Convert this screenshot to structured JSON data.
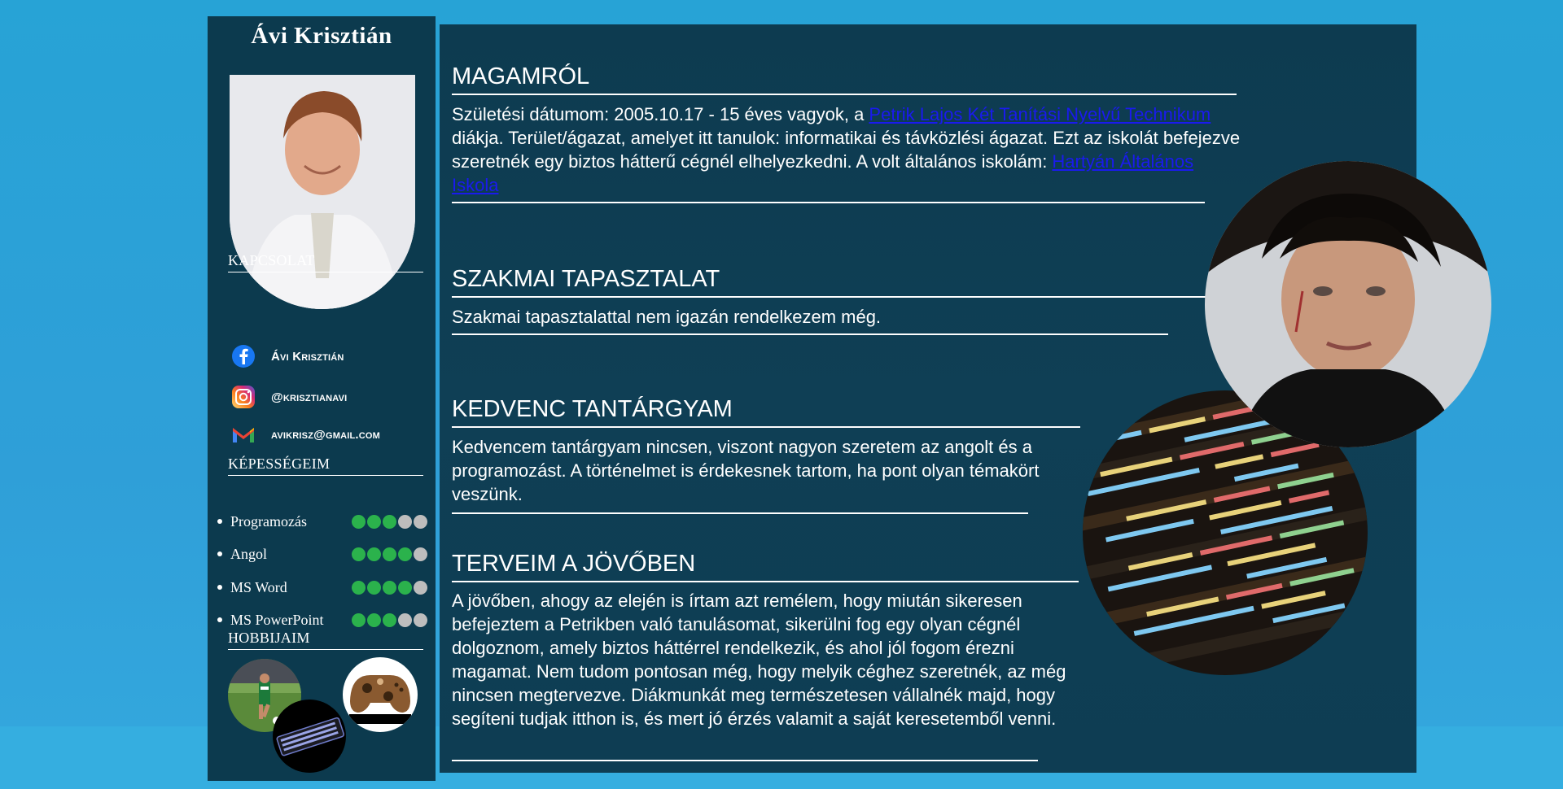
{
  "sidebar": {
    "name": "Ávi Krisztián",
    "contact_heading": "KAPCSOLAT",
    "contacts": [
      {
        "icon": "facebook-icon",
        "text": "Ávi Krisztián"
      },
      {
        "icon": "instagram-icon",
        "text": "@krisztianavi"
      },
      {
        "icon": "gmail-icon",
        "text": "avikrisz@gmail.com"
      }
    ],
    "skills_heading": "KÉPESSÉGEIM",
    "skills": [
      {
        "label": "Programozás",
        "level": 3,
        "max": 5
      },
      {
        "label": "Angol",
        "level": 4,
        "max": 5
      },
      {
        "label": "MS Word",
        "level": 4,
        "max": 5
      },
      {
        "label": "MS PowerPoint",
        "level": 3,
        "max": 5
      }
    ],
    "hobbies_heading": "HOBBIJAIM"
  },
  "main": {
    "about": {
      "title": "MAGAMRÓL",
      "text_1": "Születési dátumom: 2005.10.17 - 15 éves vagyok, a ",
      "link_1": "Petrik Lajos Két Tanítási Nyelvű Technikum",
      "text_2": " diákja. Terület/ágazat, amelyet itt tanulok: informatikai és távközlési ágazat. Ezt az iskolát befejezve szeretnék egy biztos hátterű cégnél elhelyezkedni. A volt általános iskolám: ",
      "link_2": "Hartyán Általános Iskola"
    },
    "experience": {
      "title": "SZAKMAI TAPASZTALAT",
      "text": "Szakmai tapasztalattal nem igazán rendelkezem még."
    },
    "favorite": {
      "title": "KEDVENC TANTÁRGYAM",
      "text": "Kedvencem tantárgyam nincsen, viszont nagyon szeretem az angolt és a programozást. A történelmet is érdekesnek tartom, ha pont olyan témakört veszünk."
    },
    "plans": {
      "title": "TERVEIM A JÖVŐBEN",
      "text": "A jövőben, ahogy az elején is írtam azt remélem, hogy miután sikeresen befejeztem a Petrikben való tanulásomat, sikerülni fog egy olyan cégnél dolgoznom, amely biztos háttérrel rendelkezik, és ahol jól fogom érezni magamat. Nem tudom pontosan még, hogy melyik céghez szeretnék, az még nincsen megtervezve. Diákmunkát meg természetesen vállalnék majd, hogy segíteni tudjak itthon is, és mert jó érzés valamit a saját keresetemből venni."
    }
  },
  "colors": {
    "panel": "#0c3a4e",
    "skill_on": "#2bb24c",
    "skill_off": "#bdbdbd",
    "link": "#1a1aee"
  }
}
